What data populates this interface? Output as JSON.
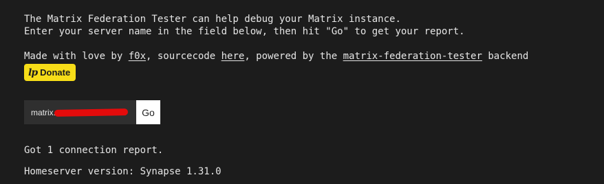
{
  "intro": {
    "line1": "The Matrix Federation Tester can help debug your Matrix instance.",
    "line2": "Enter your server name in the field below, then hit \"Go\" to get your report."
  },
  "credits": {
    "prefix": "Made with love by ",
    "author_link": "f0x",
    "source_prefix": ", sourcecode ",
    "source_link": "here",
    "powered_prefix": ", powered by the ",
    "backend_link": "matrix-federation-tester",
    "suffix": " backend"
  },
  "donate": {
    "icon": "liberapay-icon",
    "icon_glyph": "lp",
    "label": "Donate",
    "bg_color": "#f7dd18"
  },
  "form": {
    "server_value": "matrix.",
    "go_label": "Go",
    "redaction_color": "#e40b0b"
  },
  "results": {
    "connection_report": "Got 1 connection report.",
    "homeserver_version": "Homeserver version: Synapse 1.31.0"
  }
}
